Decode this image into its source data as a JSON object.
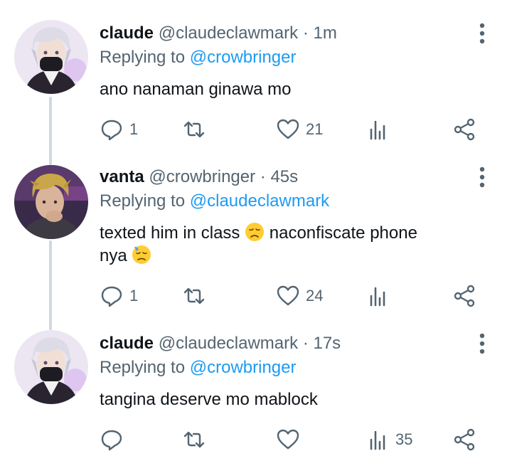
{
  "tweets": [
    {
      "name": "claude",
      "handle": "@claudeclawmark",
      "time": "· 1m",
      "replying_prefix": "Replying to",
      "replying_to": "@crowbringer",
      "text": "ano nanaman ginawa mo",
      "replies": "1",
      "retweets": "",
      "likes": "21",
      "views": ""
    },
    {
      "name": "vanta",
      "handle": "@crowbringer",
      "time": "· 45s",
      "replying_prefix": "Replying to",
      "replying_to": "@claudeclawmark",
      "text_line1": "texted him in class",
      "text_line1b": "naconfiscate phone",
      "text_line2": "nya",
      "emoji1": "disappointed-face",
      "emoji2": "downcast-face-with-sweat",
      "replies": "1",
      "retweets": "",
      "likes": "24",
      "views": ""
    },
    {
      "name": "claude",
      "handle": "@claudeclawmark",
      "time": "· 17s",
      "replying_prefix": "Replying to",
      "replying_to": "@crowbringer",
      "text": "tangina deserve mo mablock",
      "replies": "",
      "retweets": "",
      "likes": "",
      "views": "35"
    }
  ],
  "icons": {
    "reply": "reply-icon",
    "retweet": "retweet-icon",
    "like": "heart-icon",
    "views": "views-bar-icon",
    "share": "share-icon",
    "more": "more-vertical-icon"
  },
  "colors": {
    "mention": "#1d9bf0",
    "secondary_text": "#536471",
    "thread_line": "#cfd9de"
  }
}
